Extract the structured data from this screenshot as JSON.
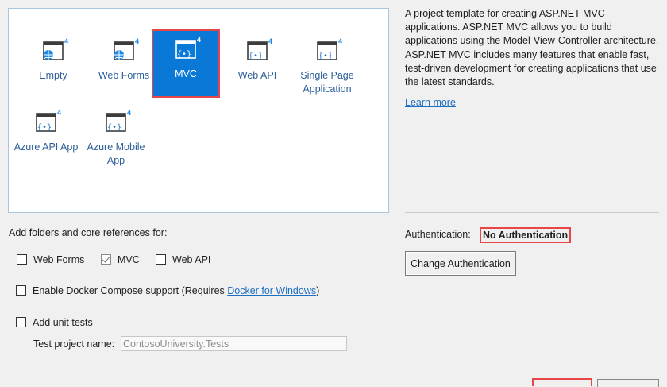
{
  "templates": [
    {
      "id": "empty",
      "label": "Empty",
      "icon": "web-globe-icon",
      "selected": false
    },
    {
      "id": "webforms",
      "label": "Web Forms",
      "icon": "web-globe-icon",
      "selected": false
    },
    {
      "id": "mvc",
      "label": "MVC",
      "icon": "code-brackets-icon",
      "selected": true
    },
    {
      "id": "webapi",
      "label": "Web API",
      "icon": "code-brackets-icon",
      "selected": false
    },
    {
      "id": "spa",
      "label": "Single Page Application",
      "icon": "code-brackets-icon",
      "selected": false
    },
    {
      "id": "azureapi",
      "label": "Azure API App",
      "icon": "code-brackets-icon",
      "selected": false
    },
    {
      "id": "azuremobile",
      "label": "Azure Mobile App",
      "icon": "code-brackets-icon",
      "selected": false
    }
  ],
  "template_badge": "4",
  "description": {
    "text": "A project template for creating ASP.NET MVC applications. ASP.NET MVC allows you to build applications using the Model-View-Controller architecture. ASP.NET MVC includes many features that enable fast, test-driven development for creating applications that use the latest standards.",
    "learn_more": "Learn more"
  },
  "authentication": {
    "label": "Authentication:",
    "value": "No Authentication",
    "change_button": "Change Authentication"
  },
  "references": {
    "label": "Add folders and core references for:",
    "options": [
      {
        "label": "Web Forms",
        "checked": false
      },
      {
        "label": "MVC",
        "checked": true
      },
      {
        "label": "Web API",
        "checked": false
      }
    ]
  },
  "docker": {
    "label": "Enable Docker Compose support (Requires",
    "link": "Docker for Windows",
    "suffix": ")",
    "checked": false
  },
  "unit_tests": {
    "label": "Add unit tests",
    "checked": false,
    "project_name_label": "Test project name:",
    "project_name_value": "ContosoUniversity.Tests"
  },
  "colors": {
    "accent": "#0a78d7",
    "highlight": "#e64646",
    "link": "#1e6fc2"
  }
}
